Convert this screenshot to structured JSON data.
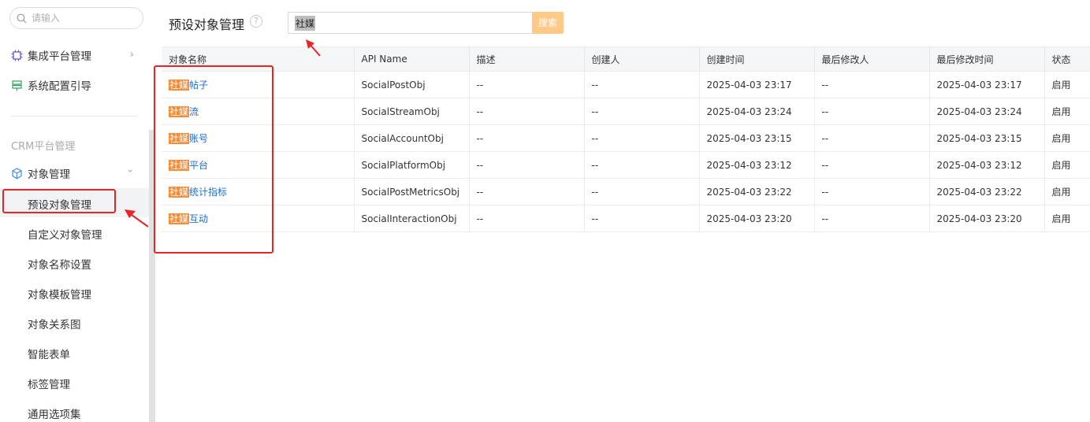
{
  "sidebar": {
    "search_placeholder": "请输入",
    "items": [
      {
        "label": "集成平台管理"
      },
      {
        "label": "系统配置引导"
      }
    ],
    "section_label": "CRM平台管理",
    "group_label": "对象管理",
    "sub_items": [
      {
        "label": "预设对象管理"
      },
      {
        "label": "自定义对象管理"
      },
      {
        "label": "对象名称设置"
      },
      {
        "label": "对象模板管理"
      },
      {
        "label": "对象关系图"
      },
      {
        "label": "智能表单"
      },
      {
        "label": "标签管理"
      },
      {
        "label": "通用选项集"
      }
    ]
  },
  "main": {
    "title": "预设对象管理",
    "help_symbol": "?",
    "search_value": "社媒",
    "search_button": "搜索"
  },
  "table": {
    "headers": [
      "对象名称",
      "API Name",
      "描述",
      "创建人",
      "创建时间",
      "最后修改人",
      "最后修改时间",
      "状态"
    ],
    "rows": [
      {
        "prefix": "社媒",
        "name": "帖子",
        "api": "SocialPostObj",
        "desc": "--",
        "creator": "--",
        "created": "2025-04-03 23:17",
        "modifier": "--",
        "modified": "2025-04-03 23:17",
        "status": "启用"
      },
      {
        "prefix": "社媒",
        "name": "流",
        "api": "SocialStreamObj",
        "desc": "--",
        "creator": "--",
        "created": "2025-04-03 23:24",
        "modifier": "--",
        "modified": "2025-04-03 23:24",
        "status": "启用"
      },
      {
        "prefix": "社媒",
        "name": "账号",
        "api": "SocialAccountObj",
        "desc": "--",
        "creator": "--",
        "created": "2025-04-03 23:15",
        "modifier": "--",
        "modified": "2025-04-03 23:15",
        "status": "启用"
      },
      {
        "prefix": "社媒",
        "name": "平台",
        "api": "SocialPlatformObj",
        "desc": "--",
        "creator": "--",
        "created": "2025-04-03 23:12",
        "modifier": "--",
        "modified": "2025-04-03 23:12",
        "status": "启用"
      },
      {
        "prefix": "社媒",
        "name": "统计指标",
        "api": "SocialPostMetricsObj",
        "desc": "--",
        "creator": "--",
        "created": "2025-04-03 23:22",
        "modifier": "--",
        "modified": "2025-04-03 23:22",
        "status": "启用"
      },
      {
        "prefix": "社媒",
        "name": "互动",
        "api": "SocialInteractionObj",
        "desc": "--",
        "creator": "--",
        "created": "2025-04-03 23:20",
        "modifier": "--",
        "modified": "2025-04-03 23:20",
        "status": "启用"
      }
    ]
  },
  "colors": {
    "accent": "#f58c3a",
    "link": "#1f6cd1",
    "annotation": "#e82525",
    "search_button": "#ffc988"
  }
}
